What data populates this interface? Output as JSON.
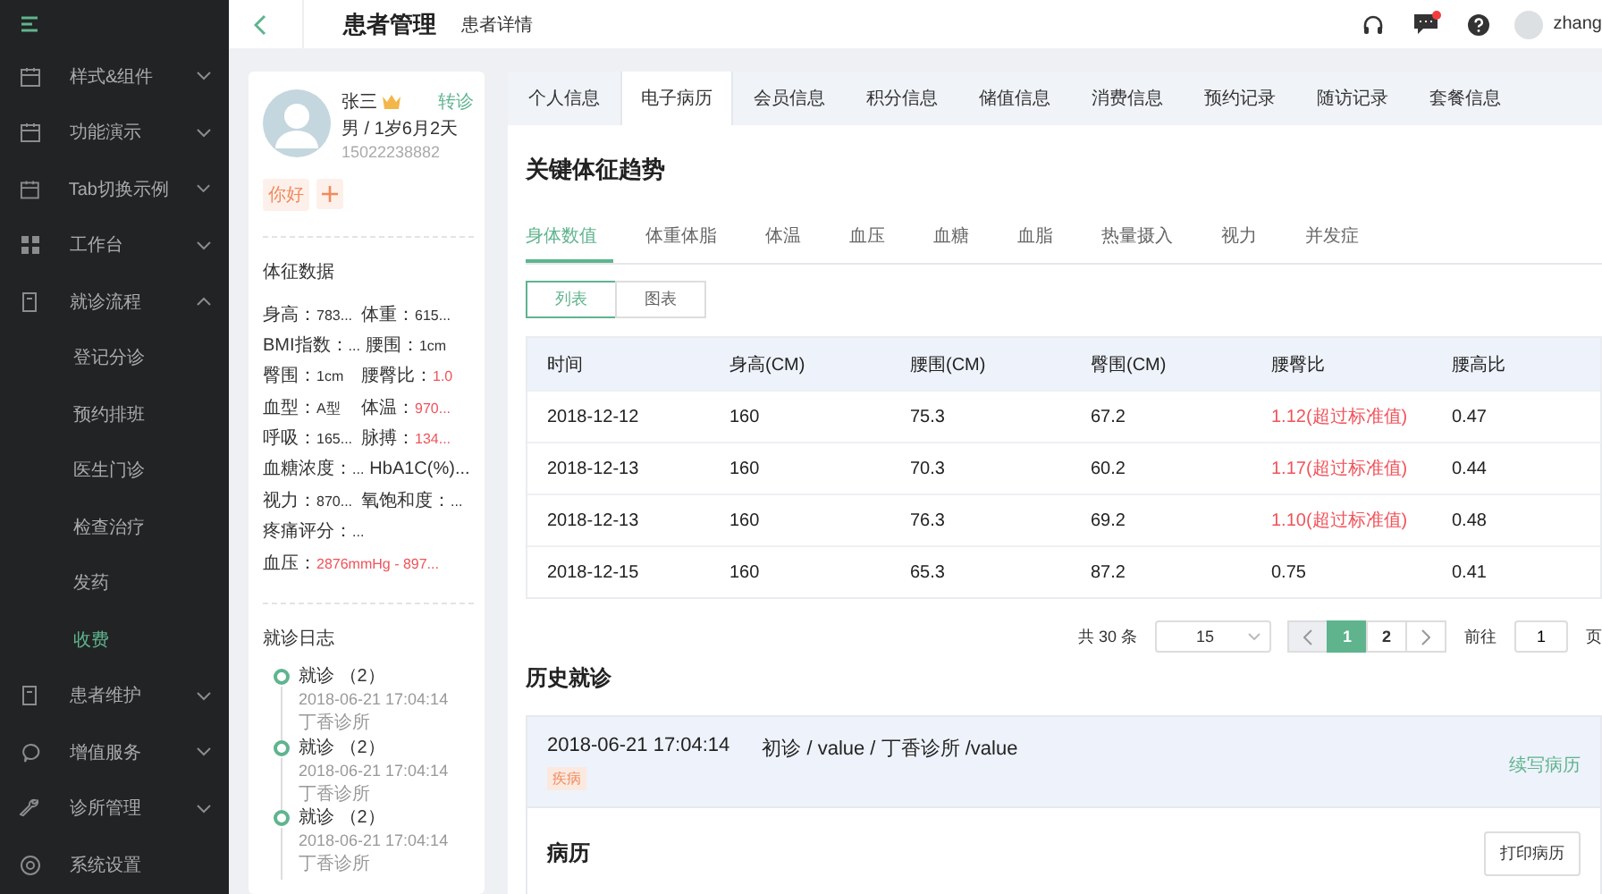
{
  "sidebar": {
    "items": [
      {
        "label": "样式&组件",
        "expanded": false,
        "selected": false
      },
      {
        "label": "功能演示",
        "expanded": false,
        "selected": false
      },
      {
        "label": "Tab切换示例",
        "expanded": false,
        "selected": false
      },
      {
        "label": "工作台",
        "expanded": false,
        "selected": false
      },
      {
        "label": "就诊流程",
        "expanded": true,
        "selected": false,
        "children": [
          {
            "label": "登记分诊",
            "selected": false
          },
          {
            "label": "预约排班",
            "selected": false
          },
          {
            "label": "医生门诊",
            "selected": false
          },
          {
            "label": "检查治疗",
            "selected": false
          },
          {
            "label": "发药",
            "selected": false
          },
          {
            "label": "收费",
            "selected": true
          }
        ]
      },
      {
        "label": "患者维护",
        "expanded": false,
        "selected": false
      },
      {
        "label": "增值服务",
        "expanded": false,
        "selected": false
      },
      {
        "label": "诊所管理",
        "expanded": false,
        "selected": false
      },
      {
        "label": "系统设置",
        "selected": false
      }
    ]
  },
  "header": {
    "title": "患者管理",
    "subtitle": "患者详情",
    "user": "zhang",
    "has_messages": true
  },
  "patient": {
    "name": "张三",
    "action": "转诊",
    "info": "男 / 1岁6月2天",
    "phone": "15022238882",
    "tags": [
      "你好"
    ]
  },
  "vitals": {
    "title": "体征数据",
    "rows": [
      [
        {
          "label": "身高：",
          "value": "783...",
          "alert": false
        },
        {
          "label": "体重：",
          "value": "615...",
          "alert": false
        }
      ],
      [
        {
          "label": "BMI指数：",
          "value": "...",
          "alert": false
        },
        {
          "label": "腰围：",
          "value": "1cm",
          "alert": false
        }
      ],
      [
        {
          "label": "臀围：",
          "value": "1cm",
          "alert": false
        },
        {
          "label": "腰臀比：",
          "value": "1.0",
          "alert": true
        }
      ],
      [
        {
          "label": "血型：",
          "value": "A型",
          "alert": false
        },
        {
          "label": "体温：",
          "value": "970...",
          "alert": true
        }
      ],
      [
        {
          "label": "呼吸：",
          "value": "165...",
          "alert": false
        },
        {
          "label": "脉搏：",
          "value": "134...",
          "alert": true
        }
      ],
      [
        {
          "label": "血糖浓度：",
          "value": "...",
          "alert": false
        },
        {
          "label": "HbA1C(%)..."
        }
      ],
      [
        {
          "label": "视力：",
          "value": "870...",
          "alert": false
        },
        {
          "label": "氧饱和度：",
          "value": "...",
          "alert": false
        }
      ],
      [
        {
          "label": "疼痛评分：",
          "value": "...",
          "alert": false
        }
      ],
      [
        {
          "label": "血压：",
          "value": "2876mmHg - 897...",
          "alert": true
        }
      ]
    ]
  },
  "log": {
    "title": "就诊日志",
    "entries": [
      {
        "title": "就诊 （2）",
        "time": "2018-06-21 17:04:14",
        "place": "丁香诊所"
      },
      {
        "title": "就诊 （2）",
        "time": "2018-06-21 17:04:14",
        "place": "丁香诊所"
      },
      {
        "title": "就诊 （2）",
        "time": "2018-06-21 17:04:14",
        "place": "丁香诊所"
      }
    ]
  },
  "tabs": [
    {
      "label": "个人信息",
      "selected": false
    },
    {
      "label": "电子病历",
      "selected": true
    },
    {
      "label": "会员信息",
      "selected": false
    },
    {
      "label": "积分信息",
      "selected": false
    },
    {
      "label": "储值信息",
      "selected": false
    },
    {
      "label": "消费信息",
      "selected": false
    },
    {
      "label": "预约记录",
      "selected": false
    },
    {
      "label": "随访记录",
      "selected": false
    },
    {
      "label": "套餐信息",
      "selected": false
    }
  ],
  "trends": {
    "title": "关键体征趋势",
    "subtabs": [
      {
        "label": "身体数值",
        "selected": true
      },
      {
        "label": "体重体脂",
        "selected": false
      },
      {
        "label": "体温",
        "selected": false
      },
      {
        "label": "血压",
        "selected": false
      },
      {
        "label": "血糖",
        "selected": false
      },
      {
        "label": "血脂",
        "selected": false
      },
      {
        "label": "热量摄入",
        "selected": false
      },
      {
        "label": "视力",
        "selected": false
      },
      {
        "label": "并发症",
        "selected": false
      }
    ],
    "views": [
      {
        "label": "列表",
        "selected": true
      },
      {
        "label": "图表",
        "selected": false
      }
    ],
    "table": {
      "columns": [
        "时间",
        "身高(CM)",
        "腰围(CM)",
        "臀围(CM)",
        "腰臀比",
        "腰高比"
      ],
      "rows": [
        [
          {
            "text": "2018-12-12",
            "alert": false
          },
          {
            "text": "160",
            "alert": false
          },
          {
            "text": "75.3",
            "alert": false
          },
          {
            "text": "67.2",
            "alert": false
          },
          {
            "text": "1.12(超过标准值)",
            "alert": true
          },
          {
            "text": "0.47",
            "alert": false
          }
        ],
        [
          {
            "text": "2018-12-13",
            "alert": false
          },
          {
            "text": "160",
            "alert": false
          },
          {
            "text": "70.3",
            "alert": false
          },
          {
            "text": "60.2",
            "alert": false
          },
          {
            "text": "1.17(超过标准值)",
            "alert": true
          },
          {
            "text": "0.44",
            "alert": false
          }
        ],
        [
          {
            "text": "2018-12-13",
            "alert": false
          },
          {
            "text": "160",
            "alert": false
          },
          {
            "text": "76.3",
            "alert": false
          },
          {
            "text": "69.2",
            "alert": false
          },
          {
            "text": "1.10(超过标准值)",
            "alert": true
          },
          {
            "text": "0.48",
            "alert": false
          }
        ],
        [
          {
            "text": "2018-12-15",
            "alert": false
          },
          {
            "text": "160",
            "alert": false
          },
          {
            "text": "65.3",
            "alert": false
          },
          {
            "text": "87.2",
            "alert": false
          },
          {
            "text": "0.75",
            "alert": false
          },
          {
            "text": "0.41",
            "alert": false
          }
        ]
      ]
    },
    "pagination": {
      "total": "共 30 条",
      "page_size": "15",
      "pages": [
        {
          "label": "1",
          "selected": true
        },
        {
          "label": "2",
          "selected": false
        }
      ],
      "goto_label": "前往",
      "goto_value": "1",
      "page_unit": "页"
    }
  },
  "history": {
    "title": "历史就诊",
    "visits": [
      {
        "time": "2018-06-21 17:04:14",
        "summary": "初诊 / value / 丁香诊所 /value",
        "tag": "疾病",
        "action": "续写病历"
      }
    ],
    "record": {
      "title": "病历",
      "button": "打印病历"
    }
  }
}
